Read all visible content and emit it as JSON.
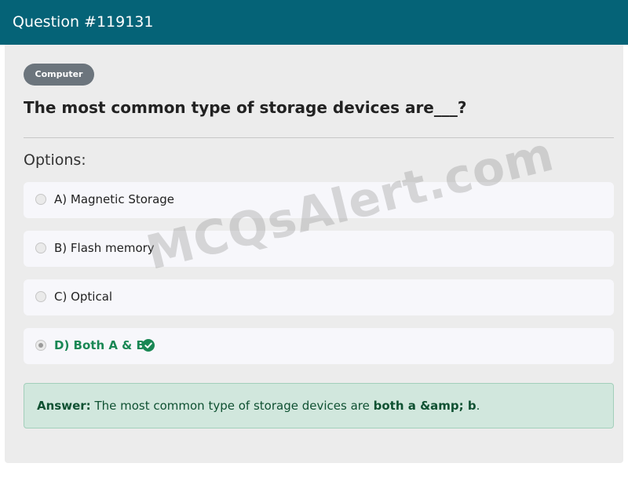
{
  "header": {
    "title": "Question #119131"
  },
  "category_badge": "Computer",
  "question": {
    "text": "The most common type of storage devices are___?"
  },
  "options_heading": "Options:",
  "options": [
    {
      "label": "A) Magnetic Storage",
      "selected": false,
      "correct": false
    },
    {
      "label": "B) Flash memory",
      "selected": false,
      "correct": false
    },
    {
      "label": "C) Optical",
      "selected": false,
      "correct": false
    },
    {
      "label": "D) Both A & B",
      "selected": true,
      "correct": true
    }
  ],
  "answer": {
    "prefix": "Answer:",
    "text": "The most common type of storage devices are",
    "highlight": "both a &amp; b",
    "suffix": "."
  },
  "watermark": "MCQsAlert.com",
  "colors": {
    "header_bg": "#056377",
    "correct": "#198754",
    "answer_bg": "#d1e7dd"
  }
}
